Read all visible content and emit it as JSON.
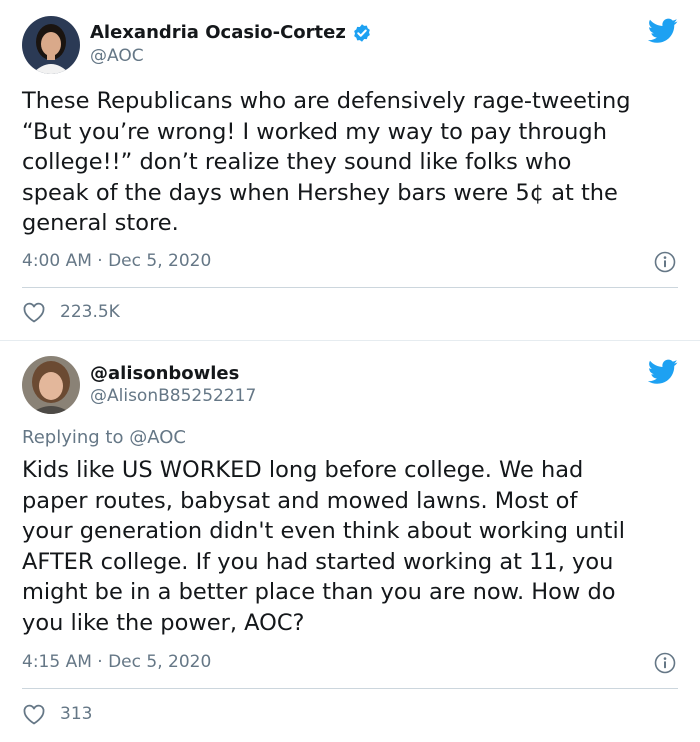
{
  "tweets": [
    {
      "display_name": "Alexandria Ocasio-Cortez",
      "handle": "@AOC",
      "verified": true,
      "text": "These Republicans who are defensively rage-tweeting\n“But you’re wrong! I worked my way to pay through\ncollege!!” don’t realize they sound like folks who\nspeak of the days when Hershey bars were 5¢ at the\ngeneral store.",
      "timestamp": "4:00 AM · Dec 5, 2020",
      "likes": "223.5K"
    },
    {
      "display_name": "@alisonbowles",
      "handle": "@AlisonB85252217",
      "verified": false,
      "replying_to_label": "Replying to ",
      "replying_to_handle": "@AOC",
      "text": "Kids like US WORKED long before college. We had\npaper routes, babysat and mowed lawns. Most of\nyour generation didn't even think about working until\nAFTER college. If you had started working at 11, you\nmight be in a better place than you are now. How do\nyou like the power, AOC?",
      "timestamp": "4:15 AM · Dec 5, 2020",
      "likes": "313"
    }
  ],
  "colors": {
    "twitter_blue": "#1da1f2",
    "text_primary": "#14171a",
    "text_secondary": "#657786",
    "divider": "#ccd6dd"
  },
  "icons": [
    "verified-badge-icon",
    "twitter-bird-icon",
    "info-icon",
    "heart-icon"
  ]
}
